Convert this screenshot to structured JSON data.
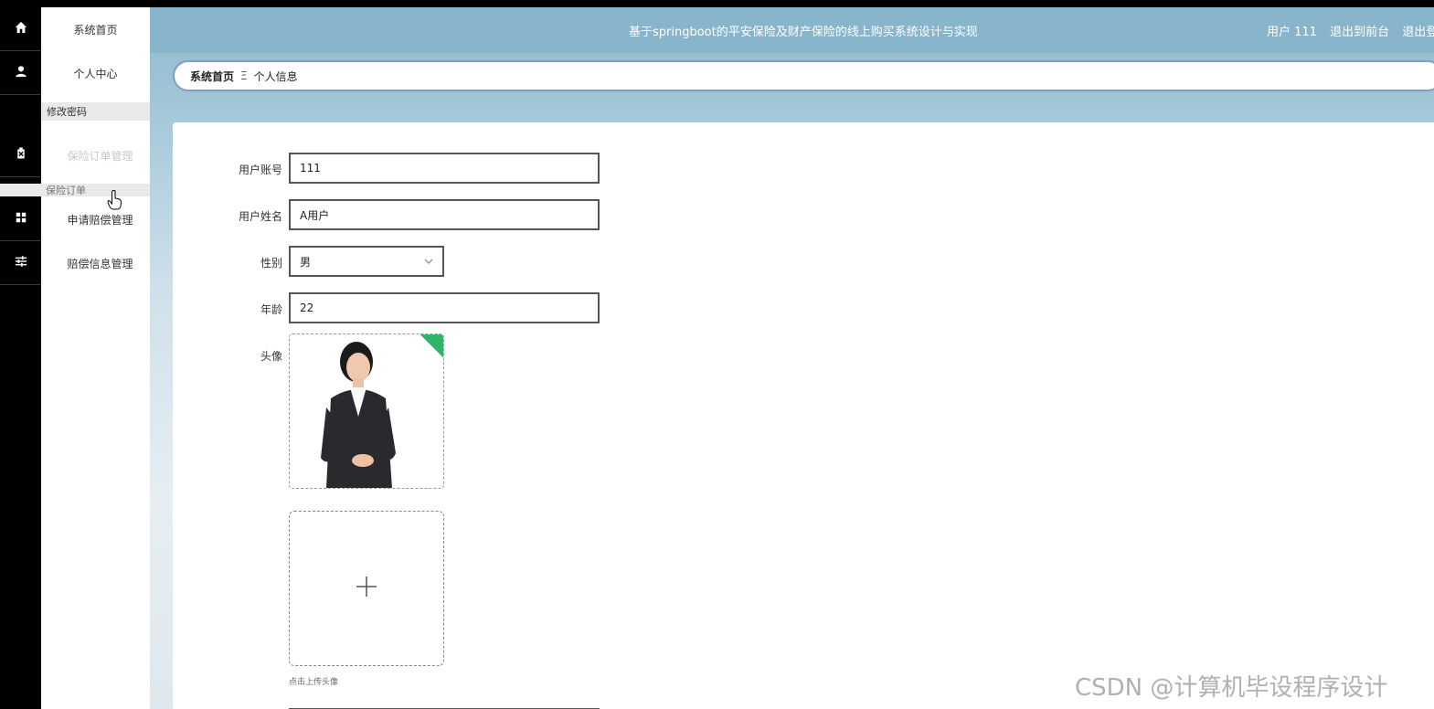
{
  "menu": {
    "items": [
      {
        "icon": "home-icon",
        "label": "系统首页"
      },
      {
        "icon": "user-icon",
        "label": "个人中心"
      },
      {
        "icon": "clipboard-icon",
        "label": "保险订单管理"
      },
      {
        "icon": "grid-icon",
        "label": "申请赔偿管理"
      },
      {
        "icon": "sliders-icon",
        "label": "赔偿信息管理"
      }
    ],
    "sub_change_password": "修改密码",
    "sub_orders": "保险订单"
  },
  "header": {
    "title": "基于springboot的平安保险及财产保险的线上购买系统设计与实现",
    "user": "用户 111",
    "to_front": "退出到前台",
    "logout": "退出登"
  },
  "breadcrumb": {
    "home": "系统首页",
    "sep": "Ξ",
    "current": "个人信息"
  },
  "form": {
    "account_label": "用户账号",
    "account_value": "111",
    "name_label": "用户姓名",
    "name_value": "A用户",
    "gender_label": "性别",
    "gender_value": "男",
    "age_label": "年龄",
    "age_value": "22",
    "avatar_label": "头像",
    "upload_tip": "点击上传头像"
  },
  "watermark": "CSDN @计算机毕设程序设计"
}
